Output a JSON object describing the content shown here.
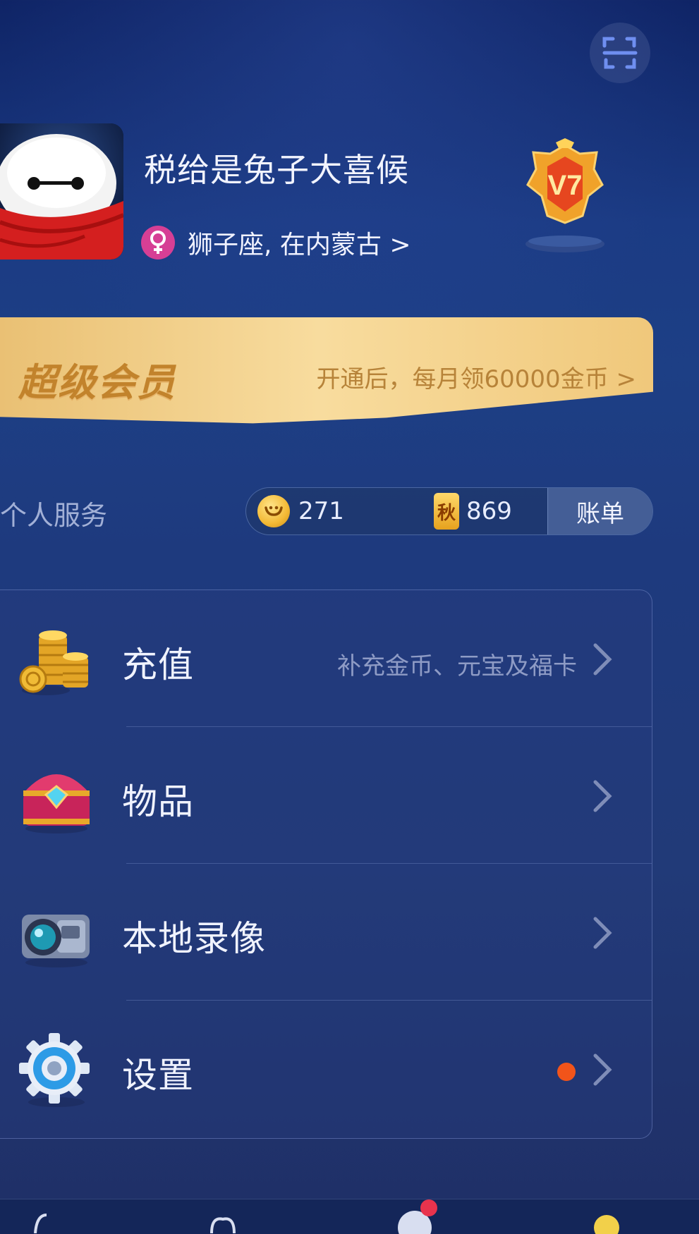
{
  "header": {
    "username": "税给是兔子大喜候",
    "subtitle": "狮子座, 在内蒙古 >",
    "gender_icon": "female-symbol-icon",
    "vip_level": "V7",
    "scan_icon": "scan-icon"
  },
  "vip_banner": {
    "title": "超级会员",
    "description": "开通后，每月领60000金币 >"
  },
  "services": {
    "section_label": "个人服务",
    "coins": "271",
    "qiu_tokens": "869",
    "qiu_label": "秋",
    "bill_button": "账单"
  },
  "menu": {
    "items": [
      {
        "label": "充值",
        "description": "补充金币、元宝及福卡",
        "icon": "coins-icon"
      },
      {
        "label": "物品",
        "description": "",
        "icon": "treasure-chest-icon"
      },
      {
        "label": "本地录像",
        "description": "",
        "icon": "camera-icon"
      },
      {
        "label": "设置",
        "description": "",
        "icon": "gear-icon",
        "has_notification": true
      }
    ]
  },
  "colors": {
    "accent_gold": "#c2832c",
    "notification": "#f2541a",
    "background": "#1e3a7e"
  }
}
